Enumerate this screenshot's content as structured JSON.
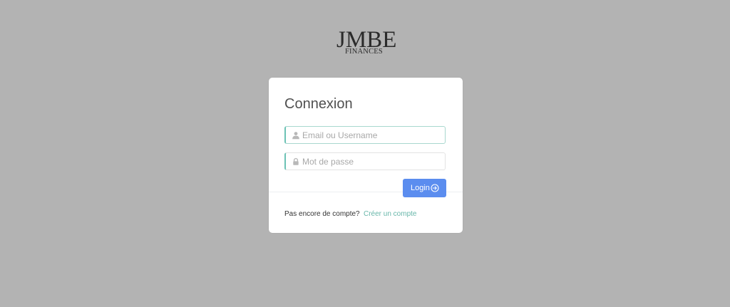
{
  "brand": {
    "name": "JMBE",
    "subtitle": "FINANCES"
  },
  "login": {
    "title": "Connexion",
    "email_placeholder": "Email ou Username",
    "password_placeholder": "Mot de passe",
    "login_label": "Login",
    "signup_prompt": "Pas encore de compte?",
    "signup_link": "Créer un compte"
  },
  "colors": {
    "background": "#b3b3b3",
    "accent": "#6cc2b5",
    "button": "#5b8def",
    "link": "#68b7aa"
  },
  "icons": {
    "email": "user-icon",
    "password": "lock-icon",
    "login": "arrow-circle-right-icon"
  }
}
